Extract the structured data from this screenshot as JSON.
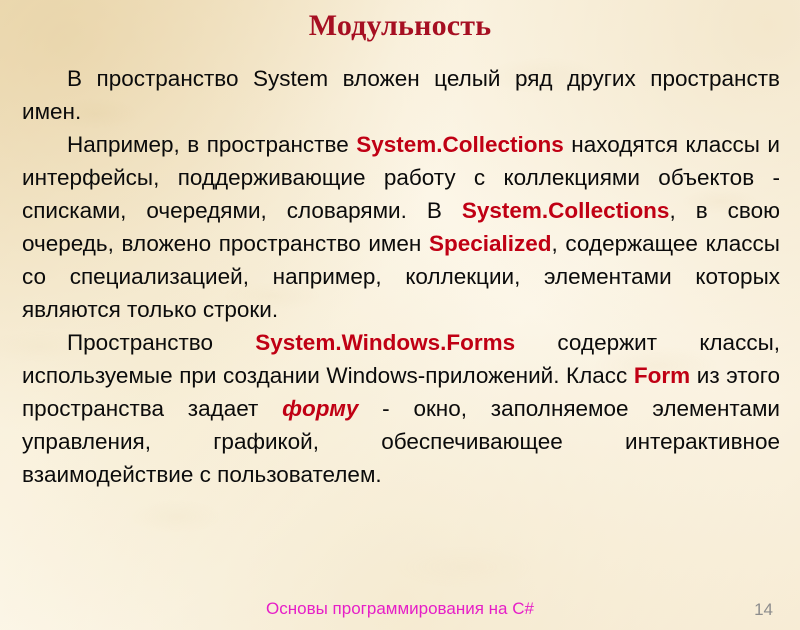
{
  "slide": {
    "title": "Модульность",
    "title_color": "#a60f22",
    "background_color": "#faf1dd",
    "highlight_color": "#c00014",
    "body_text_color": "#0b0b0b"
  },
  "paragraphs": [
    {
      "id": "paragraph-system-namespace",
      "runs": [
        {
          "text": "В пространство System вложен целый ряд других пространств имен.",
          "style": "normal"
        }
      ]
    },
    {
      "id": "paragraph-collections",
      "runs": [
        {
          "text": "Например, в пространстве ",
          "style": "normal"
        },
        {
          "text": "System.Collections",
          "style": "highlight"
        },
        {
          "text": " находятся классы и интерфейсы, поддерживающие работу с коллекциями объектов - списками, очередями, словарями. В ",
          "style": "normal"
        },
        {
          "text": "System.Collections",
          "style": "highlight"
        },
        {
          "text": ", в свою очередь, вложено пространство имен ",
          "style": "normal"
        },
        {
          "text": "Specialized",
          "style": "highlight"
        },
        {
          "text": ", содержащее классы со специализацией, например, коллекции, элементами которых являются только строки.",
          "style": "normal"
        }
      ]
    },
    {
      "id": "paragraph-windows-forms",
      "runs": [
        {
          "text": "Пространство ",
          "style": "normal"
        },
        {
          "text": "System.Windows.Forms",
          "style": "highlight"
        },
        {
          "text": " содержит классы, используемые при создании Windows-приложений. Класс ",
          "style": "normal"
        },
        {
          "text": "Form",
          "style": "highlight"
        },
        {
          "text": " из этого пространства задает ",
          "style": "normal"
        },
        {
          "text": "форму",
          "style": "highlight-italic"
        },
        {
          "text": " - окно, заполняемое элементами управления, графикой, обеспечивающее интерактивное взаимодействие с пользователем.",
          "style": "normal"
        }
      ]
    }
  ],
  "footer": {
    "text": "Основы программирования на C#",
    "text_color": "#e61fc7",
    "page_number": "14",
    "page_number_color": "#8d8d8d"
  }
}
